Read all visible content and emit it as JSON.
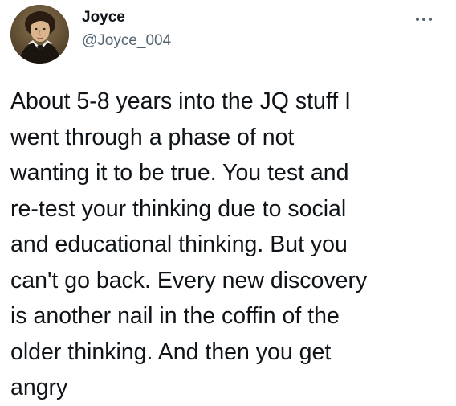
{
  "author": {
    "display_name": "Joyce",
    "handle": "@Joyce_004",
    "avatar_icon": "portrait-avatar"
  },
  "menu": {
    "icon": "more-horizontal-icon"
  },
  "tweet": {
    "lines": [
      "About 5-8 years into the JQ stuff I",
      "went through a phase of not",
      "wanting it to be true. You test and",
      "re-test your thinking due to social",
      "and educational thinking. But you",
      "can't go back. Every new discovery",
      "is another nail in the coffin of the",
      "older thinking. And then you get",
      "angry"
    ]
  },
  "colors": {
    "text": "#0f1419",
    "secondary": "#536471",
    "background": "#ffffff"
  }
}
